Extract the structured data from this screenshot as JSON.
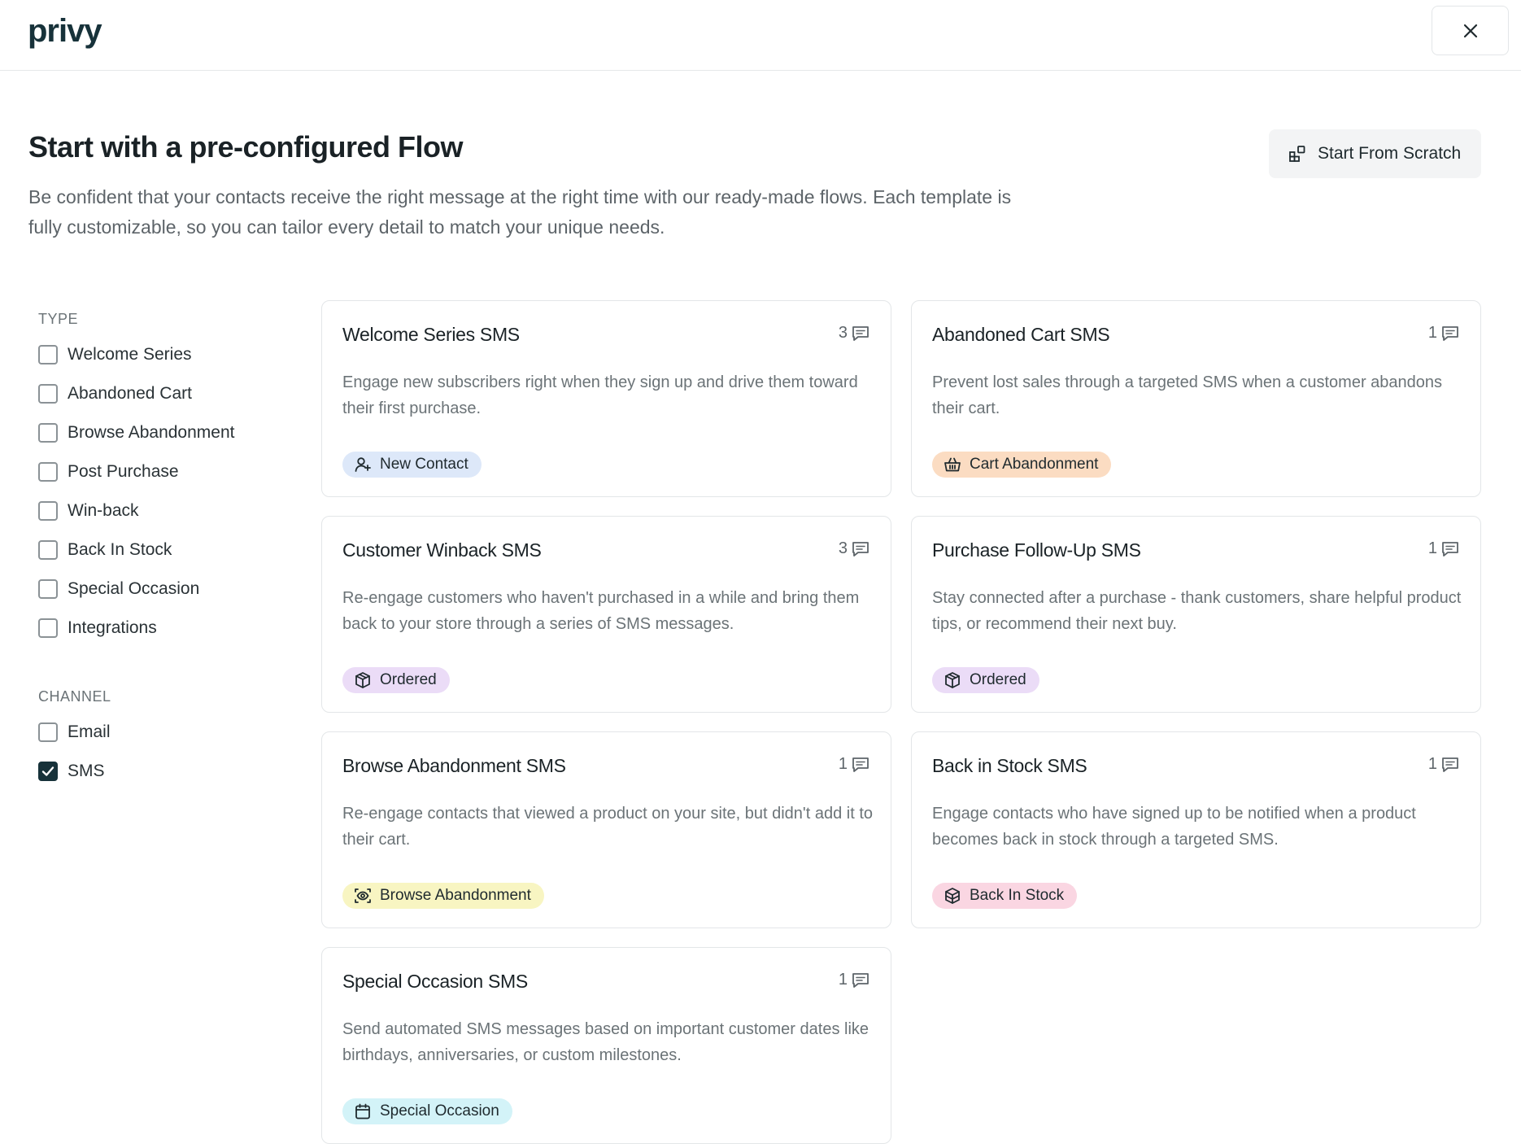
{
  "brand": {
    "logo_text": "privy"
  },
  "header": {
    "title": "Start with a pre-configured Flow",
    "description": "Be confident that your contacts receive the right message at the right time with our ready-made flows. Each template is fully customizable, so you can tailor every detail to match your unique needs.",
    "scratch_button_label": "Start From Scratch"
  },
  "filters": {
    "type_heading": "TYPE",
    "type_items": [
      {
        "label": "Welcome Series",
        "checked": false
      },
      {
        "label": "Abandoned Cart",
        "checked": false
      },
      {
        "label": "Browse Abandonment",
        "checked": false
      },
      {
        "label": "Post Purchase",
        "checked": false
      },
      {
        "label": "Win-back",
        "checked": false
      },
      {
        "label": "Back In Stock",
        "checked": false
      },
      {
        "label": "Special Occasion",
        "checked": false
      },
      {
        "label": "Integrations",
        "checked": false
      }
    ],
    "channel_heading": "CHANNEL",
    "channel_items": [
      {
        "label": "Email",
        "checked": false
      },
      {
        "label": "SMS",
        "checked": true
      }
    ]
  },
  "cards": [
    {
      "title": "Welcome Series SMS",
      "count": "3",
      "description": "Engage new subscribers right when they sign up and drive them toward their first purchase.",
      "tag": "New Contact",
      "tag_icon": "user-plus-icon",
      "tag_color": "#dde8f9"
    },
    {
      "title": "Abandoned Cart SMS",
      "count": "1",
      "description": "Prevent lost sales through a targeted SMS when a customer abandons their cart.",
      "tag": "Cart Abandonment",
      "tag_icon": "basket-icon",
      "tag_color": "#fbdcc2"
    },
    {
      "title": "Customer Winback SMS",
      "count": "3",
      "description": "Re-engage customers who haven't purchased in a while and bring them back to your store through a series of SMS messages.",
      "tag": "Ordered",
      "tag_icon": "package-icon",
      "tag_color": "#ebdcf7"
    },
    {
      "title": "Purchase Follow-Up SMS",
      "count": "1",
      "description": "Stay connected after a purchase - thank customers, share helpful product tips, or recommend their next buy.",
      "tag": "Ordered",
      "tag_icon": "package-icon",
      "tag_color": "#ebdcf7"
    },
    {
      "title": "Browse Abandonment SMS",
      "count": "1",
      "description": "Re-engage contacts that viewed a product on your site, but didn't add it to their cart.",
      "tag": "Browse Abandonment",
      "tag_icon": "eye-scan-icon",
      "tag_color": "#f8f5c2"
    },
    {
      "title": "Back in Stock SMS",
      "count": "1",
      "description": "Engage contacts who have signed up to be notified when a product becomes back in stock through a targeted SMS.",
      "tag": "Back In Stock",
      "tag_icon": "boxes-icon",
      "tag_color": "#fad6e2"
    },
    {
      "title": "Special Occasion SMS",
      "count": "1",
      "description": "Send automated SMS messages based on important customer dates like birthdays, anniversaries, or custom milestones.",
      "tag": "Special Occasion",
      "tag_icon": "calendar-icon",
      "tag_color": "#d3f3f8"
    }
  ]
}
